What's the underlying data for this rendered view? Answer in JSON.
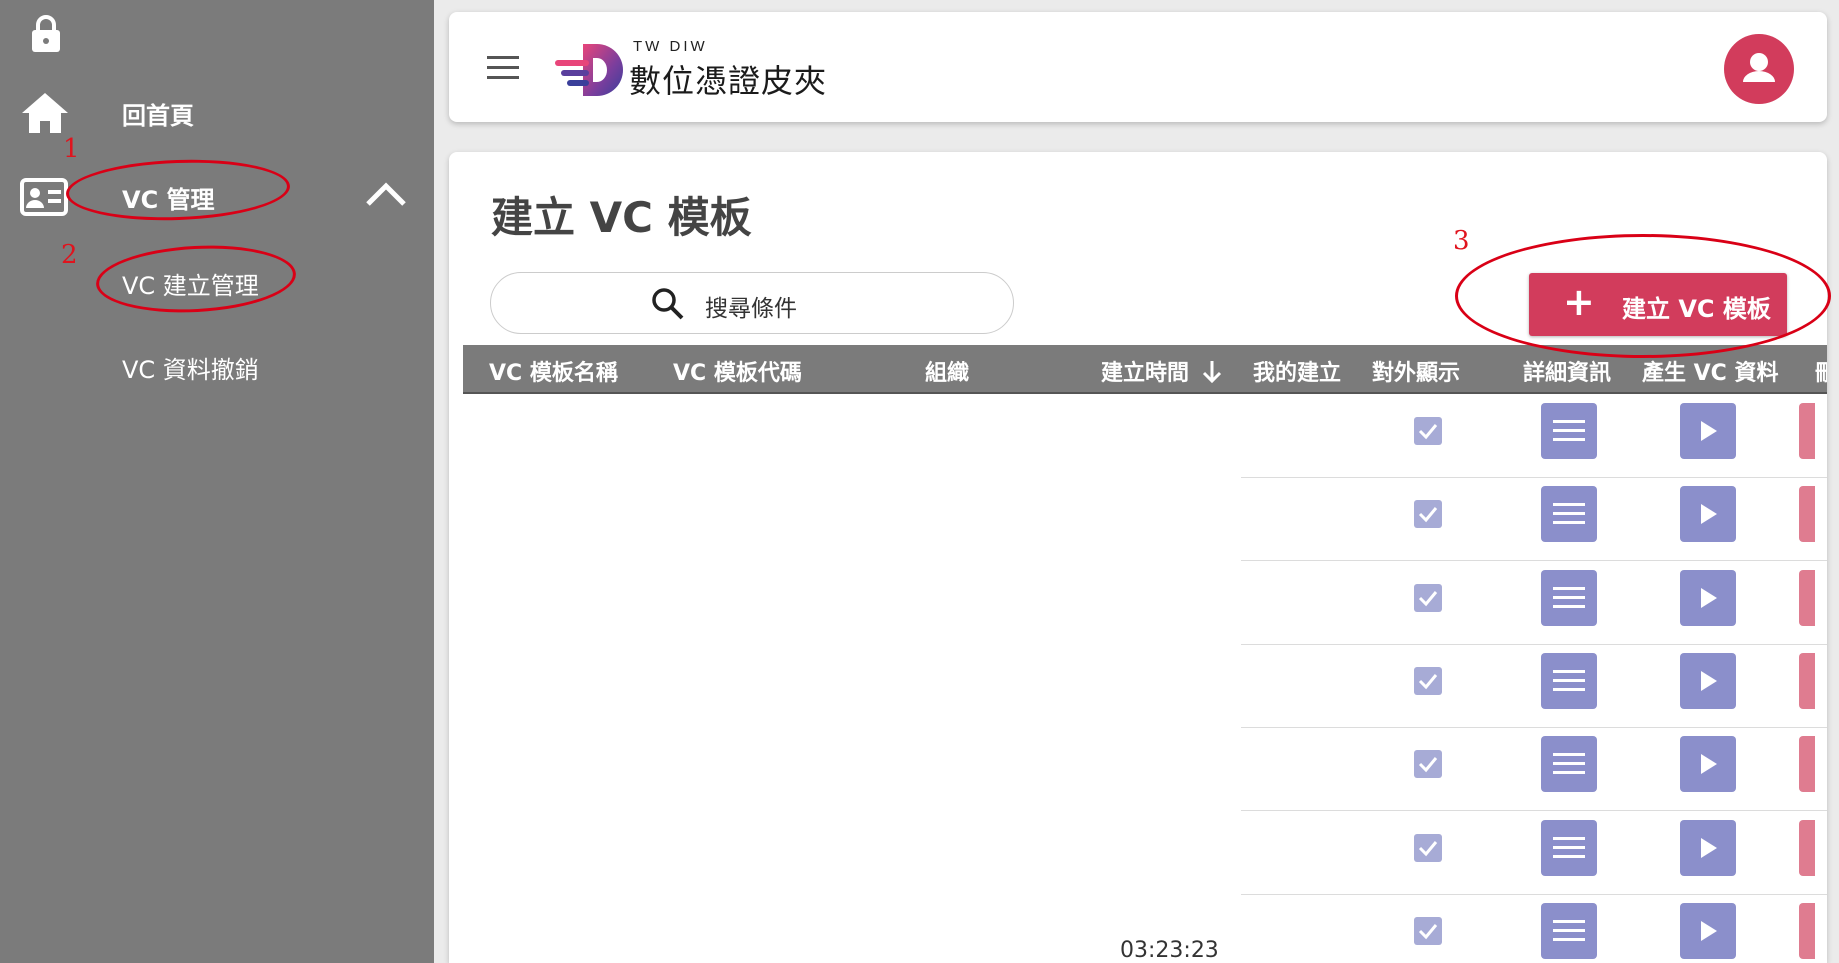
{
  "sidebar": {
    "icons": {
      "lock": "lock-icon",
      "home": "home-icon",
      "vc": "id-card-icon",
      "collapse": "chevron-up-icon"
    },
    "items": [
      {
        "label": "回首頁"
      },
      {
        "label": "VC 管理"
      },
      {
        "label": "VC 建立管理"
      },
      {
        "label": "VC 資料撤銷"
      }
    ]
  },
  "annotations": [
    "1",
    "2",
    "3"
  ],
  "header": {
    "brand_small": "TW DIW",
    "brand_name": "數位憑證皮夾",
    "icons": {
      "menu": "menu-icon",
      "user": "user-icon"
    }
  },
  "main": {
    "title": "建立 VC 模板",
    "search_label": "搜尋條件",
    "create_button": "建立 VC 模板",
    "columns": [
      "VC 模板名稱",
      "VC 模板代碼",
      "組織",
      "建立時間",
      "我的建立",
      "對外顯示",
      "詳細資訊",
      "產生 VC 資料"
    ],
    "rows": [
      {
        "public": true
      },
      {
        "public": true
      },
      {
        "public": true
      },
      {
        "public": true
      },
      {
        "public": true
      },
      {
        "public": true
      },
      {
        "public": true,
        "created_time": "03:23:23"
      }
    ]
  },
  "colors": {
    "sidebar": "#7b7b7b",
    "accent": "#d23c5c",
    "action": "#8b8fcb",
    "annotation": "#d90016"
  }
}
